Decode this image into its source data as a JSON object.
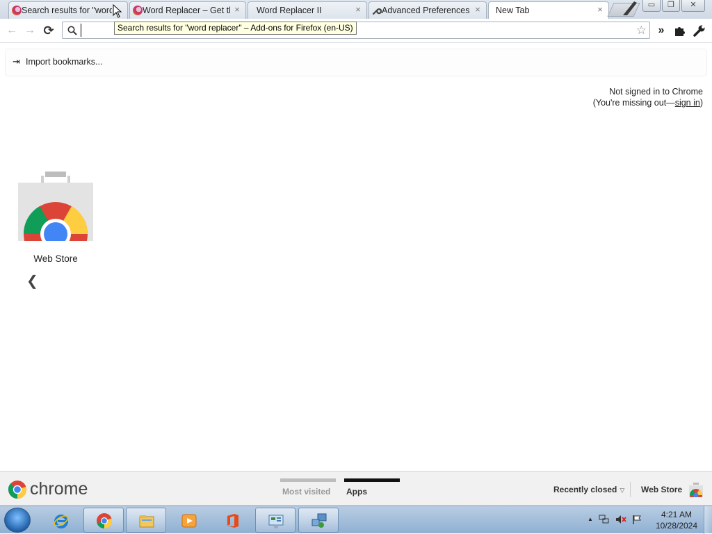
{
  "tabs": [
    {
      "label": "Search results for \"word",
      "icon": "firefox-icon",
      "active": false
    },
    {
      "label": "Word Replacer – Get th",
      "icon": "firefox-icon",
      "active": false
    },
    {
      "label": "Word Replacer II",
      "icon": "",
      "active": false
    },
    {
      "label": "Advanced Preferences",
      "icon": "wrench-icon",
      "active": false
    },
    {
      "label": "New Tab",
      "icon": "",
      "active": true
    }
  ],
  "tab_close_glyph": "×",
  "window_controls": {
    "minimize": "▭",
    "restore": "❐",
    "close": "✕"
  },
  "toolbar": {
    "back": "←",
    "forward": "→",
    "reload": "⟳",
    "omnibox_value": "",
    "bookmark_star": "☆",
    "overflow": "»",
    "extensions": "✚",
    "wrench": "🔧"
  },
  "tooltip": "Search results for \"word replacer\" – Add-ons for Firefox (en-US)",
  "bookmarks_bar": {
    "import_label": "Import bookmarks...",
    "import_icon": "⇥"
  },
  "signin": {
    "line1": "Not signed in to Chrome",
    "line2_prefix": "(You're missing out—",
    "link": "sign in",
    "line2_suffix": ")"
  },
  "apps": [
    {
      "label": "Web Store"
    }
  ],
  "prev_arrow": "❮",
  "footer": {
    "brand": "chrome",
    "tabs": [
      {
        "label": "Most visited",
        "selected": false
      },
      {
        "label": "Apps",
        "selected": true
      }
    ],
    "recently_closed": "Recently closed",
    "recently_closed_arrow": "▽",
    "web_store": "Web Store"
  },
  "taskbar": {
    "pinned": [
      "internet-explorer-icon",
      "chrome-icon",
      "file-explorer-icon",
      "media-player-icon",
      "office-icon",
      "control-panel-icon",
      "network-icon"
    ],
    "tray_up": "▲",
    "clock_time": "4:21 AM",
    "clock_date": "10/28/2024"
  },
  "colors": {
    "tooltip_bg": "#ffffe1",
    "tabstrip": "#cfd9e5",
    "footer_bg": "#f1f1f1",
    "taskbar": "#a6c0dd"
  }
}
